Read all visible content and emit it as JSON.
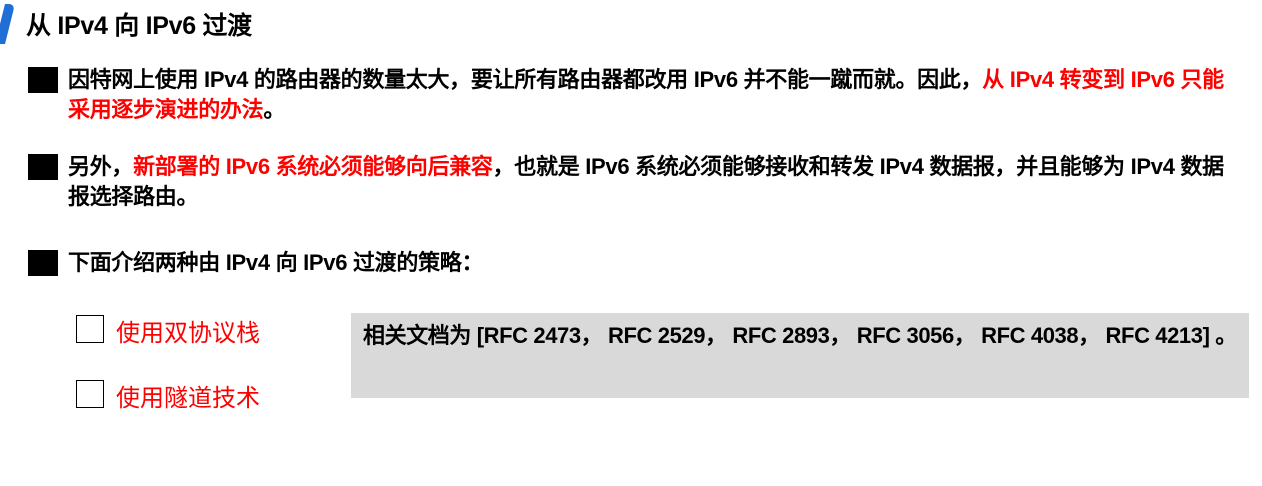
{
  "title": "从 IPv4 向 IPv6 过渡",
  "accent_color": "#1f6fd6",
  "highlight_color": "#ff0000",
  "bullets": [
    {
      "segments": [
        {
          "text": "因特网上使用 IPv4 的路由器的数量太大，要让所有路由器都改用 IPv6 并不能一蹴而就。因此，",
          "red": false
        },
        {
          "text": "从 IPv4 转变到 IPv6 只能采用逐步演进的办法",
          "red": true
        },
        {
          "text": "。",
          "red": false
        }
      ]
    },
    {
      "segments": [
        {
          "text": "另外，",
          "red": false
        },
        {
          "text": "新部署的 IPv6 系统必须能够向后兼容",
          "red": true
        },
        {
          "text": "，也就是 IPv6 系统必须能够接收和转发 IPv4 数据报，并且能够为 IPv4 数据报选择路由。",
          "red": false
        }
      ]
    },
    {
      "segments": [
        {
          "text": "下面介绍两种由 IPv4 向 IPv6 过渡的策略：",
          "red": false
        }
      ]
    }
  ],
  "strategies": [
    "使用双协议栈",
    "使用隧道技术"
  ],
  "note": "相关文档为 [RFC 2473， RFC 2529， RFC 2893， RFC 3056， RFC 4038， RFC 4213] 。"
}
